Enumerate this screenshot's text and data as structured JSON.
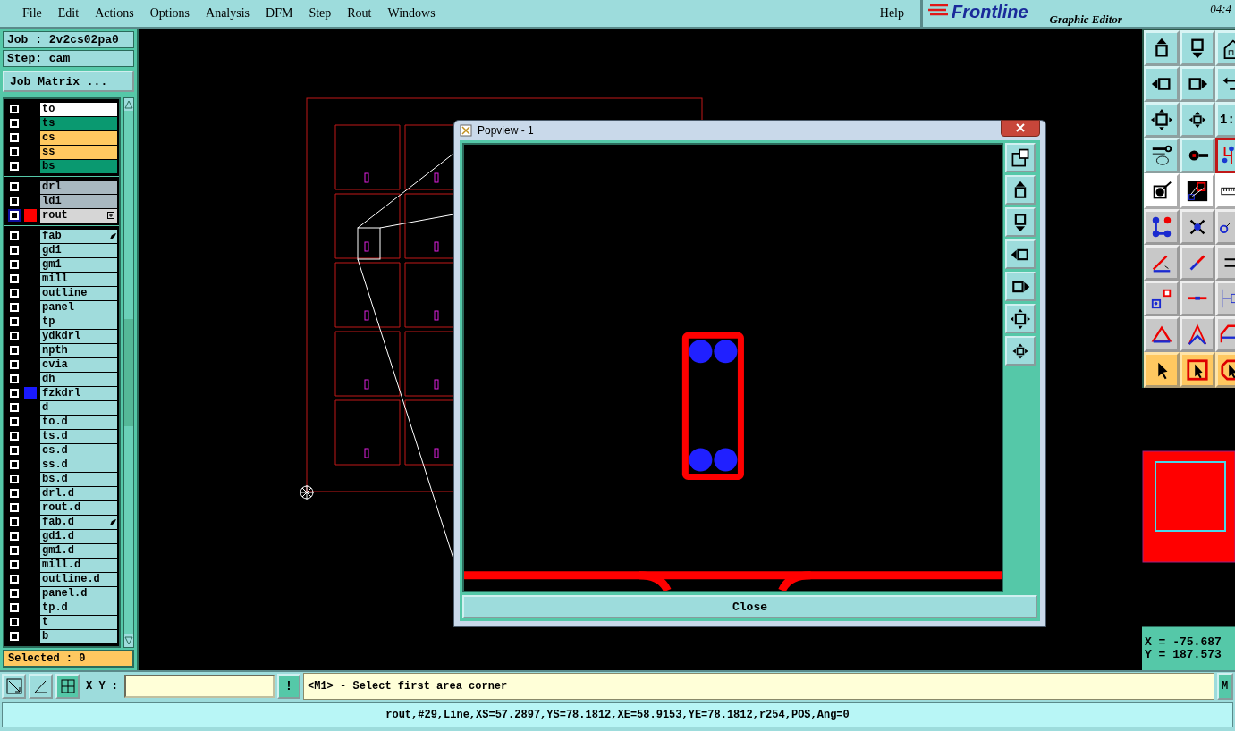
{
  "menu": [
    {
      "label": "File"
    },
    {
      "label": "Edit"
    },
    {
      "label": "Actions"
    },
    {
      "label": "Options"
    },
    {
      "label": "Analysis"
    },
    {
      "label": "DFM"
    },
    {
      "label": "Step"
    },
    {
      "label": "Rout"
    },
    {
      "label": "Windows"
    }
  ],
  "help": "Help",
  "logo": {
    "brand": "Frontline",
    "subtitle": "Graphic Editor",
    "clock": "04:4"
  },
  "job": "Job : 2v2cs02pa0",
  "step": "Step: cam",
  "job_matrix_button": "Job Matrix ...",
  "layer_groups": [
    [
      {
        "name": "to",
        "color": "#ffffff",
        "selected": false,
        "kind": "plain"
      },
      {
        "name": "ts",
        "color": "#0a9970",
        "selected": false,
        "kind": "plain"
      },
      {
        "name": "cs",
        "color": "#ffc860",
        "selected": false,
        "kind": "plain"
      },
      {
        "name": "ss",
        "color": "#ffc860",
        "selected": false,
        "kind": "plain"
      },
      {
        "name": "bs",
        "color": "#0a9970",
        "selected": false,
        "kind": "plain"
      }
    ],
    [
      {
        "name": "drl",
        "color": "#a8b8c0",
        "selected": false,
        "kind": "plain"
      },
      {
        "name": "ldi",
        "color": "#a8b8c0",
        "selected": false,
        "kind": "plain"
      },
      {
        "name": "rout",
        "color": "#d6d6d6",
        "selected": true,
        "swatch": {
          "color": "#ff0000"
        },
        "kind": "expand"
      }
    ],
    [
      {
        "name": "fab",
        "color": "#a0dcdc",
        "selected": false,
        "kind": "hand"
      },
      {
        "name": "gd1",
        "color": "#a0dcdc",
        "selected": false,
        "kind": "plain"
      },
      {
        "name": "gm1",
        "color": "#a0dcdc",
        "selected": false,
        "kind": "plain"
      },
      {
        "name": "mill",
        "color": "#a0dcdc",
        "selected": false,
        "kind": "plain"
      },
      {
        "name": "outline",
        "color": "#a0dcdc",
        "selected": false,
        "kind": "plain"
      },
      {
        "name": "panel",
        "color": "#a0dcdc",
        "selected": false,
        "kind": "plain"
      },
      {
        "name": "tp",
        "color": "#a0dcdc",
        "selected": false,
        "kind": "plain"
      },
      {
        "name": "ydkdrl",
        "color": "#a0dcdc",
        "selected": false,
        "kind": "plain"
      },
      {
        "name": "npth",
        "color": "#a0dcdc",
        "selected": false,
        "kind": "plain"
      },
      {
        "name": "cvia",
        "color": "#a0dcdc",
        "selected": false,
        "kind": "plain"
      },
      {
        "name": "dh",
        "color": "#a0dcdc",
        "selected": false,
        "kind": "plain"
      },
      {
        "name": "fzkdrl",
        "color": "#a0dcdc",
        "selected": false,
        "swatch": {
          "color": "#1a1aff"
        },
        "kind": "plain"
      },
      {
        "name": "d",
        "color": "#a0dcdc",
        "selected": false,
        "kind": "plain"
      },
      {
        "name": "to.d",
        "color": "#a0dcdc",
        "selected": false,
        "kind": "plain"
      },
      {
        "name": "ts.d",
        "color": "#a0dcdc",
        "selected": false,
        "kind": "plain"
      },
      {
        "name": "cs.d",
        "color": "#a0dcdc",
        "selected": false,
        "kind": "plain"
      },
      {
        "name": "ss.d",
        "color": "#a0dcdc",
        "selected": false,
        "kind": "plain"
      },
      {
        "name": "bs.d",
        "color": "#a0dcdc",
        "selected": false,
        "kind": "plain"
      },
      {
        "name": "drl.d",
        "color": "#a0dcdc",
        "selected": false,
        "kind": "plain"
      },
      {
        "name": "rout.d",
        "color": "#a0dcdc",
        "selected": false,
        "kind": "plain"
      },
      {
        "name": "fab.d",
        "color": "#a0dcdc",
        "selected": false,
        "kind": "hand"
      },
      {
        "name": "gd1.d",
        "color": "#a0dcdc",
        "selected": false,
        "kind": "plain"
      },
      {
        "name": "gm1.d",
        "color": "#a0dcdc",
        "selected": false,
        "kind": "plain"
      },
      {
        "name": "mill.d",
        "color": "#a0dcdc",
        "selected": false,
        "kind": "plain"
      },
      {
        "name": "outline.d",
        "color": "#a0dcdc",
        "selected": false,
        "kind": "plain"
      },
      {
        "name": "panel.d",
        "color": "#a0dcdc",
        "selected": false,
        "kind": "plain"
      },
      {
        "name": "tp.d",
        "color": "#a0dcdc",
        "selected": false,
        "kind": "plain"
      },
      {
        "name": "t",
        "color": "#a0dcdc",
        "selected": false,
        "kind": "plain"
      },
      {
        "name": "b",
        "color": "#a0dcdc",
        "selected": false,
        "kind": "plain"
      }
    ]
  ],
  "selected_count": "Selected : 0",
  "popview": {
    "title": "Popview - 1",
    "close_button": "Close"
  },
  "tool_buttons": [
    {
      "selected": false
    },
    {
      "selected": false
    },
    {
      "selected": false
    },
    {
      "selected": false
    },
    {
      "selected": false
    },
    {
      "selected": false
    },
    {
      "selected": false
    },
    {
      "selected": false
    },
    {
      "selected": false,
      "label": "1:"
    },
    {
      "selected": false
    },
    {
      "selected": false
    },
    {
      "selected": true
    },
    {
      "selected": false
    },
    {
      "selected": false
    },
    {
      "selected": false
    },
    {
      "selected": false
    },
    {
      "selected": false
    },
    {
      "selected": false
    },
    {
      "selected": false
    },
    {
      "selected": false
    },
    {
      "selected": false
    },
    {
      "selected": false
    },
    {
      "selected": false
    },
    {
      "selected": false
    },
    {
      "selected": false
    },
    {
      "selected": false
    },
    {
      "selected": false
    },
    {
      "selected": false
    },
    {
      "selected": false
    },
    {
      "selected": false
    }
  ],
  "coordinates": {
    "x": "X = -75.687",
    "y": "Y = 187.573"
  },
  "command_bar": {
    "xy_label": "X Y :",
    "bang_button": "!",
    "message": "<M1> - Select first area corner",
    "edge_button": "M"
  },
  "status_line": "rout,#29,Line,XS=57.2897,YS=78.1812,XE=58.9153,YE=78.1812,r254,POS,Ang=0"
}
